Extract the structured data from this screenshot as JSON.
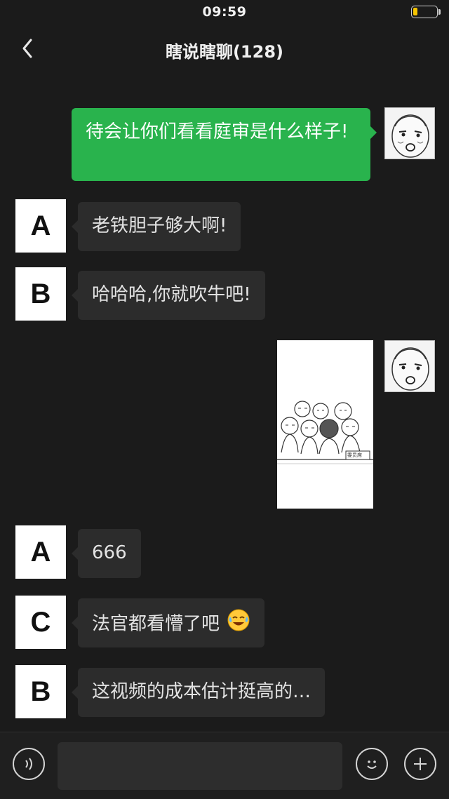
{
  "status_bar": {
    "time": "09:59"
  },
  "header": {
    "title": "瞎说瞎聊(128)"
  },
  "messages": [
    {
      "sender": "me",
      "text": "待会让你们看看庭审是什么样子!"
    },
    {
      "sender": "A",
      "text": "老铁胆子够大啊!"
    },
    {
      "sender": "B",
      "text": "哈哈哈,你就吹牛吧!"
    },
    {
      "sender": "me",
      "type": "image",
      "image_text": "委员席"
    },
    {
      "sender": "A",
      "text": "666"
    },
    {
      "sender": "C",
      "text": "法官都看懵了吧"
    },
    {
      "sender": "B",
      "text": "这视频的成本估计挺高的…"
    }
  ],
  "colors": {
    "background": "#1b1b1b",
    "my_bubble": "#29b34d",
    "their_bubble": "#2c2c2c",
    "battery": "#f5c400"
  },
  "icons": {
    "back": "chevron-left-icon",
    "voice": "voice-icon",
    "emoji": "emoji-icon",
    "add": "plus-icon"
  }
}
